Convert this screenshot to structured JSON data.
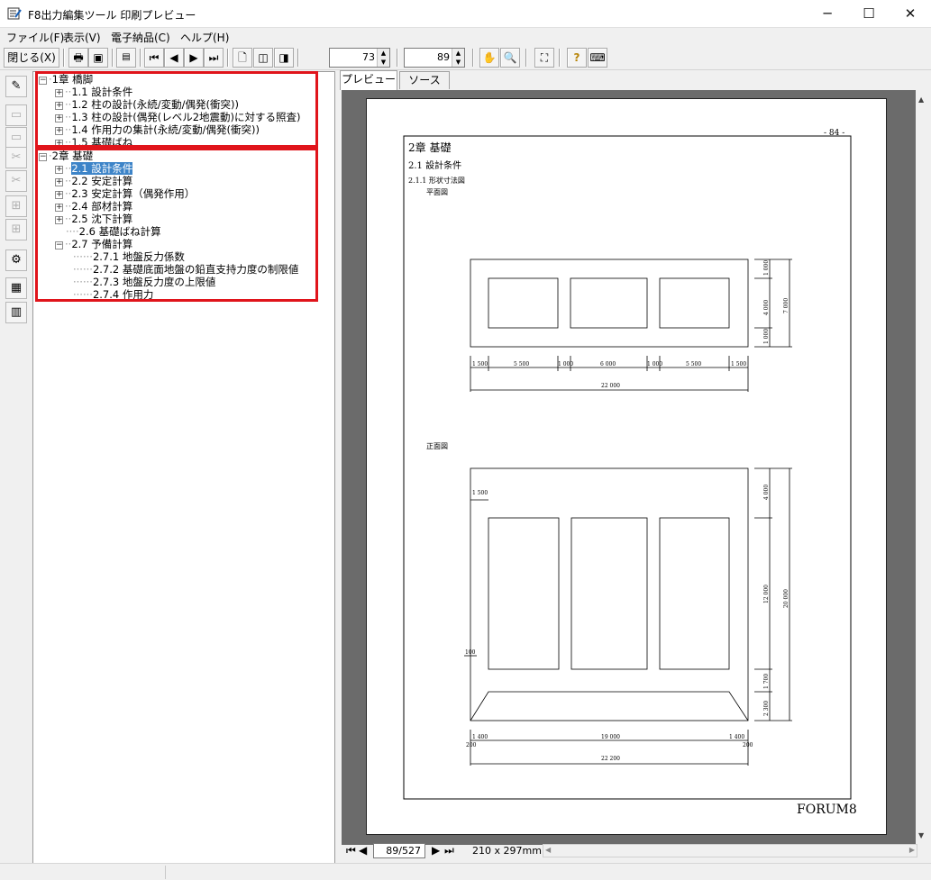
{
  "window": {
    "title": "F8出力編集ツール 印刷プレビュー",
    "minimize": "─",
    "maximize": "☐",
    "close": "✕"
  },
  "menu": [
    "ファイル(F)",
    "表示(V)",
    "電子納品(C)",
    "ヘルプ(H)"
  ],
  "toolbar": {
    "close_label": "閉じる(X)",
    "spin1": "73",
    "spin2": "89"
  },
  "tree": {
    "ch1": {
      "label": "1章 橋脚",
      "items": [
        "1.1 設計条件",
        "1.2 柱の設計(永続/変動/偶発(衝突))",
        "1.3 柱の設計(偶発(レベル2地震動)に対する照査)",
        "1.4 作用力の集計(永続/変動/偶発(衝突))",
        "1.5 基礎ばね"
      ]
    },
    "ch2": {
      "label": "2章 基礎",
      "items": [
        "2.1 設計条件",
        "2.2 安定計算",
        "2.3 安定計算（偶発作用）",
        "2.4 部材計算",
        "2.5 沈下計算",
        "2.6 基礎ばね計算",
        "2.7 予備計算"
      ],
      "sub": [
        "2.7.1 地盤反力係数",
        "2.7.2 基礎底面地盤の鉛直支持力度の制限値",
        "2.7.3 地盤反力度の上限値",
        "2.7.4 作用力"
      ]
    }
  },
  "tabs": [
    "プレビュー",
    "ソース"
  ],
  "page": {
    "number": "- 84 -",
    "chapter": "2章 基礎",
    "section": "2.1 設計条件",
    "subsection": "2.1.1 形状寸法図",
    "plan_label": "平面図",
    "front_label": "正面図",
    "footer": "FORUM8",
    "plan_dims": {
      "d1": "1 500",
      "d2": "5 500",
      "d3": "1 000",
      "d4": "6 000",
      "d5": "1 000",
      "d6": "5 500",
      "d7": "1 500",
      "total": "22 000",
      "v1": "1 000",
      "v2": "4 000",
      "v3": "1 000",
      "vtotal": "7 000"
    },
    "front_dims": {
      "top": "1 500",
      "v1": "4 000",
      "v2": "12 000",
      "v3": "1 700",
      "v4": "2 300",
      "vtotal": "20 000",
      "side": "100",
      "b1": "1 400",
      "b2": "19 000",
      "b3": "1 400",
      "b4": "200",
      "b5": "200",
      "total": "22 200"
    }
  },
  "nav": {
    "page": "89/527",
    "paper": "210 x 297mm"
  }
}
